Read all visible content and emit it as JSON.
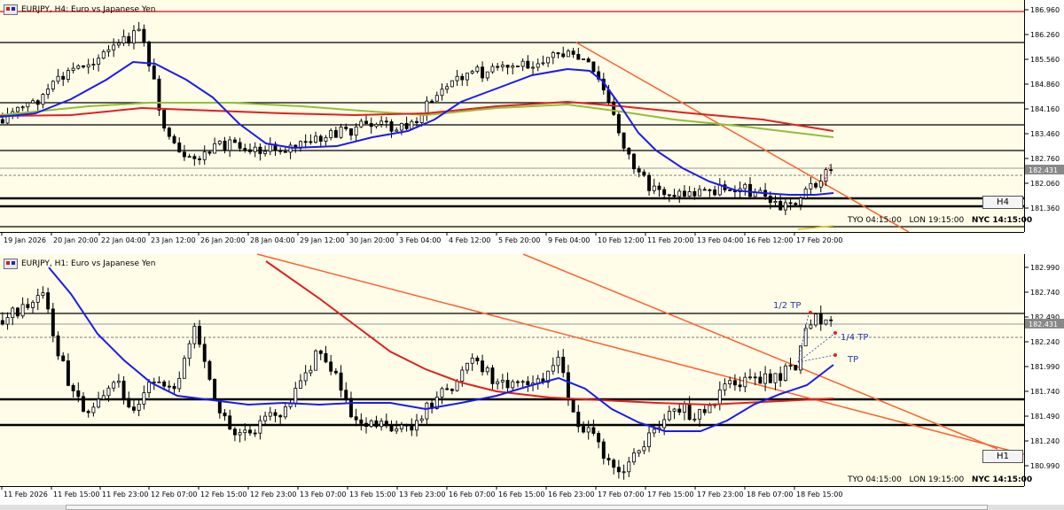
{
  "colors": {
    "background": "#fffde8",
    "candle_up": "#ffffff",
    "candle_down": "#000000",
    "ma_blue": "#1a1af0",
    "ma_red": "#e02020",
    "ma_green": "#8fbf3a",
    "trendline": "#ff6030",
    "resistance_top": "#e03030"
  },
  "h4": {
    "title": "EURJPY, H4:  Euro vs Japanese Yen",
    "tf_label": "H4",
    "session": {
      "tyo": "TYO 04:15:00",
      "lon": "LON 19:15:00",
      "nyc": "NYC 14:15:00"
    },
    "current_price": "182.431",
    "price_ticks": [
      "186.960",
      "186.260",
      "185.560",
      "184.860",
      "184.160",
      "183.460",
      "182.760",
      "182.060",
      "181.360"
    ],
    "time_ticks": [
      "19 Jan 2026",
      "20 Jan 20:00",
      "22 Jan 04:00",
      "23 Jan 12:00",
      "26 Jan 20:00",
      "28 Jan 04:00",
      "29 Jan 12:00",
      "30 Jan 20:00",
      "3 Feb 04:00",
      "4 Feb 12:00",
      "5 Feb 20:00",
      "9 Feb 04:00",
      "10 Feb 12:00",
      "11 Feb 20:00",
      "13 Feb 04:00",
      "16 Feb 12:00",
      "17 Feb 20:00"
    ]
  },
  "h1": {
    "title": "EURJPY, H1:  Euro vs Japanese Yen",
    "tf_label": "H1",
    "session": {
      "tyo": "TYO 04:15:00",
      "lon": "LON 19:15:00",
      "nyc": "NYC 14:15:00"
    },
    "current_price": "182.431",
    "price_ticks": [
      "182.990",
      "182.740",
      "182.490",
      "182.240",
      "181.990",
      "181.740",
      "181.490",
      "181.240",
      "180.990"
    ],
    "time_ticks": [
      "11 Feb 2026",
      "11 Feb 15:00",
      "11 Feb 23:00",
      "12 Feb 07:00",
      "12 Feb 15:00",
      "12 Feb 23:00",
      "13 Feb 07:00",
      "13 Feb 15:00",
      "13 Feb 23:00",
      "16 Feb 07:00",
      "16 Feb 15:00",
      "16 Feb 23:00",
      "17 Feb 07:00",
      "17 Feb 15:00",
      "17 Feb 23:00",
      "18 Feb 07:00",
      "18 Feb 15:00"
    ],
    "tp_labels": {
      "half": "1/2 TP",
      "quarter": "1/4 TP",
      "tp": "TP"
    }
  }
}
